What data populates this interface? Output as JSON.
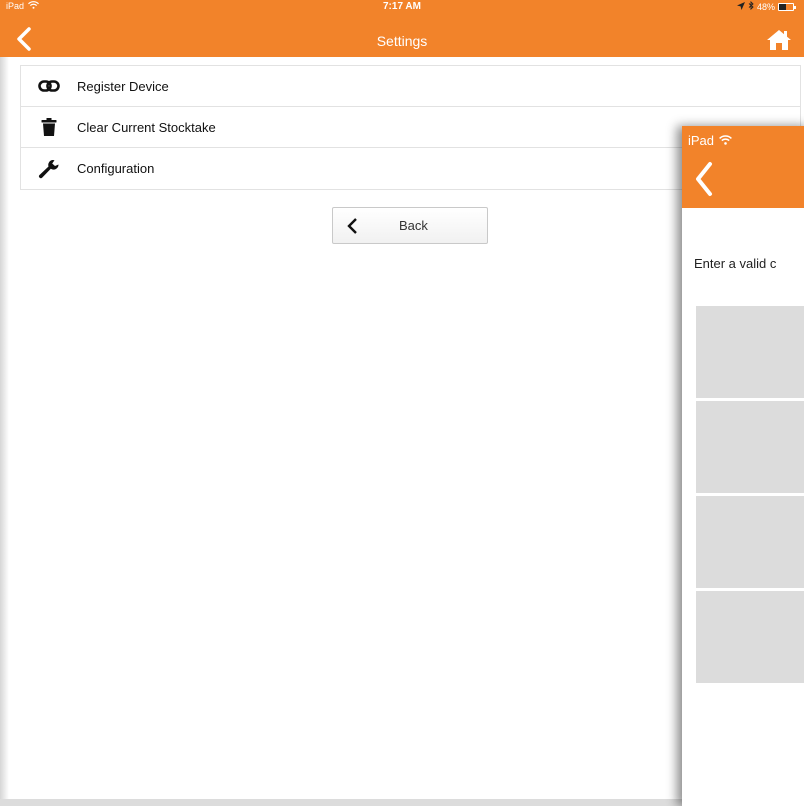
{
  "main": {
    "status": {
      "device": "iPad",
      "time": "7:17 AM",
      "battery": "48%"
    },
    "nav": {
      "title": "Settings"
    },
    "menu": [
      {
        "label": "Register Device",
        "icon": "link-icon"
      },
      {
        "label": "Clear Current Stocktake",
        "icon": "trash-icon"
      },
      {
        "label": "Configuration",
        "icon": "wrench-icon"
      }
    ],
    "back_button": {
      "label": "Back"
    }
  },
  "overlay": {
    "status": {
      "device": "iPad"
    },
    "prompt": "Enter a valid c",
    "tiles": [
      "",
      "",
      "",
      ""
    ]
  },
  "colors": {
    "accent": "#f2832a",
    "tile": "#dcdcdc"
  }
}
